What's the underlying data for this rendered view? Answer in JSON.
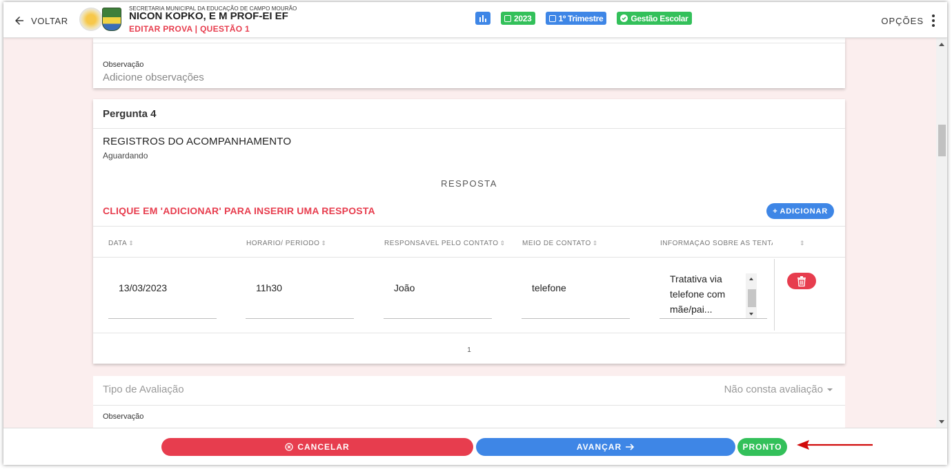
{
  "header": {
    "back_label": "VOLTAR",
    "org_name": "SECRETARIA MUNICIPAL DA EDUCAÇÃO DE CAMPO MOURÃO",
    "school_name": "NICON KOPKO, E M PROF-EI EF",
    "subtitle": "EDITAR PROVA | QUESTÃO 1",
    "badges": [
      {
        "label": "",
        "icon": "chart-icon",
        "color": "#3e86e6"
      },
      {
        "label": "2023",
        "icon": "calendar-icon",
        "color": "#33c05a"
      },
      {
        "label": "1º Trimestre",
        "icon": "calendar-icon",
        "color": "#3e86e6"
      },
      {
        "label": "Gestão Escolar",
        "icon": "check-circle-icon",
        "color": "#33c05a"
      }
    ],
    "options_label": "OPÇÕES"
  },
  "observation_top": {
    "label": "Observação",
    "placeholder": "Adicione observações"
  },
  "question": {
    "title": "Pergunta 4",
    "record_title": "REGISTROS DO ACOMPANHAMENTO",
    "record_status": "Aguardando",
    "response_heading": "RESPOSTA",
    "instruction": "CLIQUE EM 'ADICIONAR' PARA INSERIR UMA RESPOSTA",
    "add_label": "ADICIONAR",
    "columns": [
      "DATA",
      "HORÁRIO/ PERÍODO",
      "RESPONSÁVEL PELO CONTATO",
      "MEIO DE CONTATO",
      "INFORMAÇÃO SOBRE AS TENTATIVAS"
    ],
    "row": {
      "date": "13/03/2023",
      "time": "11h30",
      "responsible": "João",
      "contact_means": "telefone",
      "info": "Tratativa via telefone com mãe/pai..."
    },
    "page": "1"
  },
  "evaluation": {
    "label": "Tipo de Avaliação",
    "value": "Não consta avaliação"
  },
  "observation_bottom": {
    "label": "Observação"
  },
  "footer": {
    "cancel_label": "CANCELAR",
    "next_label": "AVANÇAR",
    "done_label": "PRONTO"
  },
  "colors": {
    "accent_red": "#e73d4e",
    "accent_blue": "#3e86e6",
    "accent_green": "#33c05a"
  }
}
